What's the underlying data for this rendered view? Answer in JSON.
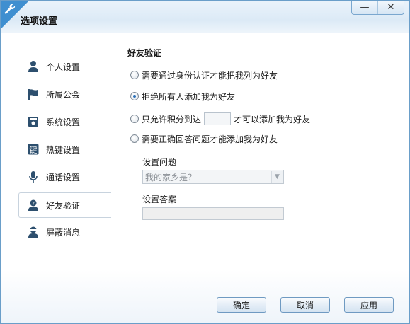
{
  "window": {
    "title": "选项设置",
    "minimize_glyph": "—",
    "close_glyph": "✕"
  },
  "sidebar": {
    "items": [
      {
        "label": "个人设置",
        "icon": "person-icon"
      },
      {
        "label": "所属公会",
        "icon": "flag-icon"
      },
      {
        "label": "系统设置",
        "icon": "system-icon"
      },
      {
        "label": "热键设置",
        "icon": "hotkey-icon"
      },
      {
        "label": "通话设置",
        "icon": "microphone-icon"
      },
      {
        "label": "好友验证",
        "icon": "friend-verify-icon",
        "active": true
      },
      {
        "label": "屏蔽消息",
        "icon": "block-message-icon"
      }
    ]
  },
  "verify": {
    "section_title": "好友验证",
    "options": {
      "identity": "需要通过身份认证才能把我列为好友",
      "reject_all": "拒绝所有人添加我为好友",
      "score_prefix": "只允许积分到达",
      "score_suffix": "才可以添加我为好友",
      "question": "需要正确回答问题才能添加我为好友"
    },
    "selected": "reject_all",
    "score_value": "",
    "question_label": "设置问题",
    "question_value": "我的家乡是？",
    "answer_label": "设置答案",
    "answer_value": ""
  },
  "buttons": {
    "ok": "确定",
    "cancel": "取消",
    "apply": "应用"
  },
  "colors": {
    "accent": "#3f8fd0",
    "icon_dark": "#2d4f6e",
    "radio_dot": "#2b6fb8"
  }
}
